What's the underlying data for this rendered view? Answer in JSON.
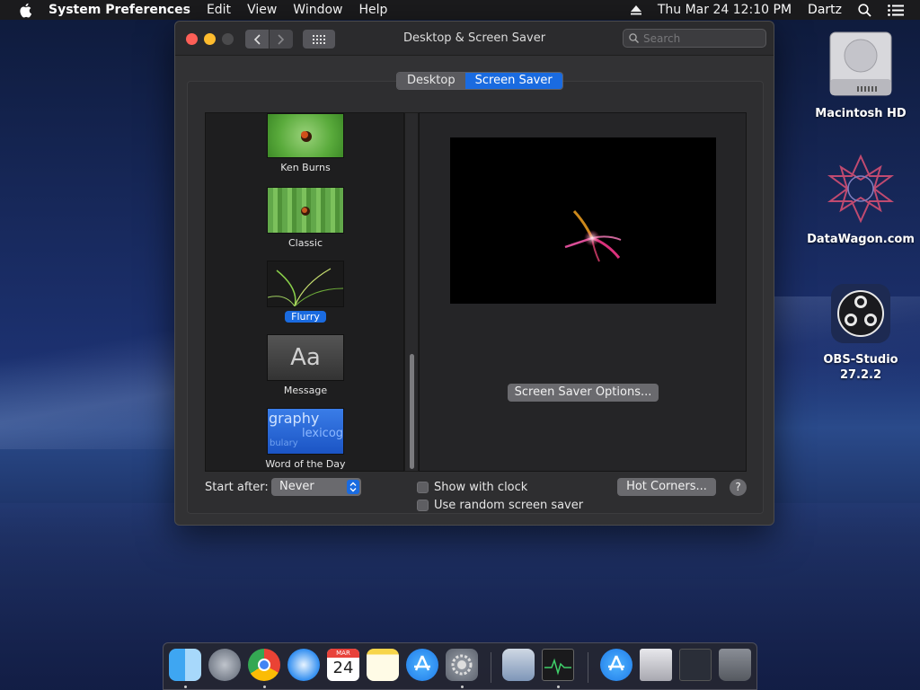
{
  "menubar": {
    "app_name": "System Preferences",
    "items": [
      "Edit",
      "View",
      "Window",
      "Help"
    ],
    "datetime": "Thu Mar 24  12:10 PM",
    "user": "Dartz",
    "icons": [
      "apple-icon",
      "eject-icon",
      "spotlight-search-icon",
      "notification-center-icon"
    ]
  },
  "window": {
    "title": "Desktop & Screen Saver",
    "search_placeholder": "Search",
    "tabs": [
      {
        "label": "Desktop",
        "active": false
      },
      {
        "label": "Screen Saver",
        "active": true
      }
    ],
    "savers": [
      {
        "label": "Ken Burns",
        "selected": false
      },
      {
        "label": "Classic",
        "selected": false
      },
      {
        "label": "Flurry",
        "selected": true
      },
      {
        "label": "Message",
        "selected": false,
        "thumb_text": "Aa"
      },
      {
        "label": "Word of the Day",
        "selected": false,
        "thumb_words": [
          "graphy",
          "lexicog",
          "bulary"
        ]
      }
    ],
    "options_button": "Screen Saver Options...",
    "start_after_label": "Start after:",
    "start_after_value": "Never",
    "show_with_clock": {
      "label": "Show with clock",
      "checked": false
    },
    "random_saver": {
      "label": "Use random screen saver",
      "checked": false
    },
    "hot_corners_button": "Hot Corners...",
    "help_label": "?"
  },
  "desktop_icons": [
    {
      "label": "Macintosh HD"
    },
    {
      "label": "DataWagon.com"
    },
    {
      "label": "OBS-Studio 27.2.2"
    }
  ],
  "dock": {
    "calendar_month": "MAR",
    "calendar_day": "24",
    "apps": [
      "Finder",
      "Launchpad",
      "Chrome",
      "Safari",
      "Calendar",
      "Notes",
      "App Store",
      "System Preferences",
      "Preview",
      "Activity Monitor",
      "App Store Downloads",
      "Documents",
      "Desktop Stack",
      "Trash"
    ]
  },
  "colors": {
    "accent": "#1a6be0",
    "close": "#fe5f57",
    "minimize": "#febc2e"
  }
}
